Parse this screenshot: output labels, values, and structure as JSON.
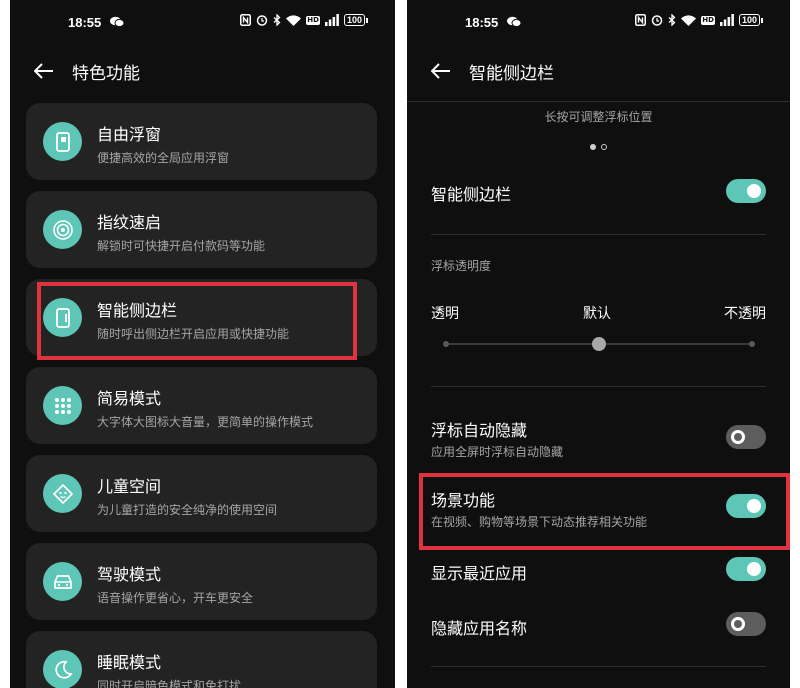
{
  "left": {
    "status": {
      "time": "18:55",
      "battery": "100"
    },
    "title": "特色功能",
    "cards": [
      {
        "title": "自由浮窗",
        "subtitle": "便捷高效的全局应用浮窗",
        "icon": "floating-window-icon"
      },
      {
        "title": "指纹速启",
        "subtitle": "解锁时可快捷开启付款码等功能",
        "icon": "fingerprint-icon"
      },
      {
        "title": "智能侧边栏",
        "subtitle": "随时呼出侧边栏开启应用或快捷功能",
        "icon": "sidebar-icon"
      },
      {
        "title": "简易模式",
        "subtitle": "大字体大图标大音量，更简单的操作模式",
        "icon": "grid-icon"
      },
      {
        "title": "儿童空间",
        "subtitle": "为儿童打造的安全纯净的使用空间",
        "icon": "child-face-icon"
      },
      {
        "title": "驾驶模式",
        "subtitle": "语音操作更省心，开车更安全",
        "icon": "car-icon"
      },
      {
        "title": "睡眠模式",
        "subtitle": "同时开启暗色模式和免打扰",
        "icon": "moon-icon"
      }
    ]
  },
  "right": {
    "status": {
      "time": "18:55",
      "battery": "100"
    },
    "title": "智能侧边栏",
    "hint": "长按可调整浮标位置",
    "sidebar_toggle": {
      "label": "智能侧边栏",
      "on": true
    },
    "opacity": {
      "section_label": "浮标透明度",
      "min_label": "透明",
      "mid_label": "默认",
      "max_label": "不透明",
      "value": 0.5
    },
    "auto_hide": {
      "label": "浮标自动隐藏",
      "desc": "应用全屏时浮标自动隐藏",
      "on": false
    },
    "scene": {
      "label": "场景功能",
      "desc": "在视频、购物等场景下动态推荐相关功能",
      "on": true
    },
    "recent": {
      "label": "显示最近应用",
      "on": true
    },
    "hide_names": {
      "label": "隐藏应用名称",
      "on": false
    }
  },
  "colors": {
    "accent": "#5ec6b6",
    "highlight": "#e03340",
    "card": "#232323",
    "background": "#0f0f0f"
  }
}
